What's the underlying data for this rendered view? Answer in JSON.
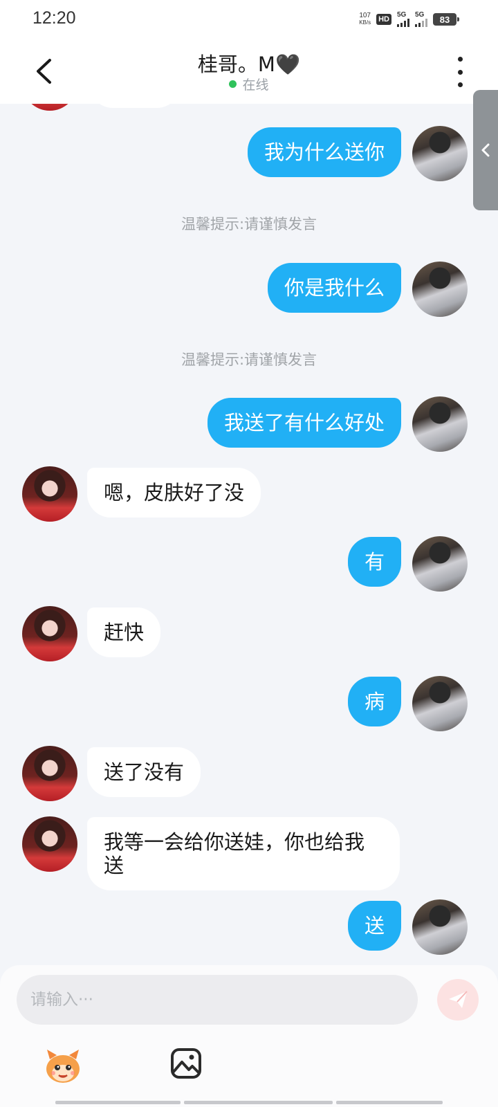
{
  "status_bar": {
    "time": "12:20",
    "net_speed_value": "107",
    "net_speed_unit": "KB/s",
    "hd_label": "HD",
    "sim1_label": "5G",
    "sim2_label": "5G",
    "battery": "83"
  },
  "header": {
    "title": "桂哥。M🖤",
    "status": "在线"
  },
  "messages": [
    {
      "sender": "self",
      "text": "我为什么送你"
    },
    {
      "type": "hint",
      "text": "温馨提示:请谨慎发言"
    },
    {
      "sender": "self",
      "text": "你是我什么"
    },
    {
      "type": "hint",
      "text": "温馨提示:请谨慎发言"
    },
    {
      "sender": "self",
      "text": "我送了有什么好处"
    },
    {
      "sender": "other",
      "text": "嗯，皮肤好了没"
    },
    {
      "sender": "self",
      "text": "有"
    },
    {
      "sender": "other",
      "text": "赶快"
    },
    {
      "sender": "self",
      "text": "病"
    },
    {
      "sender": "other",
      "text": "送了没有"
    },
    {
      "sender": "other",
      "line1": "我等一会给你送娃，你也给我",
      "line2": "送"
    },
    {
      "sender": "self",
      "text": "送"
    }
  ],
  "input": {
    "placeholder": "请输入···",
    "value": ""
  },
  "toolbar": {
    "sticker_icon": "sticker-mascot-icon",
    "image_icon": "image-icon",
    "send_icon": "send-plane-icon"
  },
  "colors": {
    "self_bubble": "#21b0f5",
    "other_bubble": "#ffffff",
    "background": "#f3f5f9",
    "online": "#2fc25b",
    "send_button": "#fce2e2"
  }
}
